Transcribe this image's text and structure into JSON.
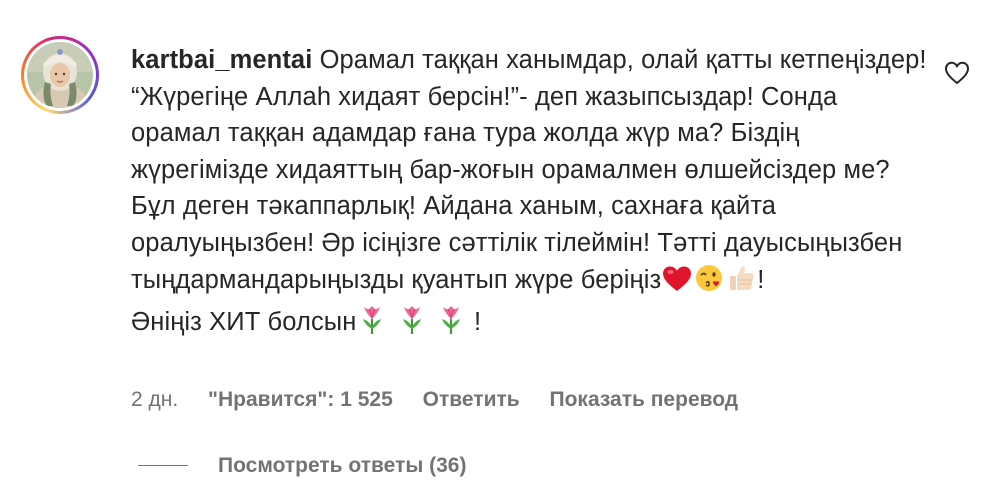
{
  "comment": {
    "username": "kartbai_mentai",
    "text_1": " Орамал таққан ханымдар, олай қатты кетпеңіздер! “Жүрегіңе Аллаһ хидаят берсін!”- деп жазыпсыздар! Сонда орамал таққан адамдар ғана тура жолда жүр ма? Біздің жүрегімізде хидаяттың бар-жоғын орамалмен өлшейсіздер ме? Бұл деген тәкаппарлық! Айдана ханым, сахнаға қайта оралуыңызбен! Әр ісіңізге сәттілік тілеймін! Тәтті дауысыңызбен тыңдармандарыңызды қуантып жүре беріңіз",
    "text_2": "!",
    "text_3": "Әніңіз ХИТ болсын",
    "text_4": " !",
    "emoji_row_1": [
      "heart-emoji",
      "kiss-wink-emoji",
      "thumbs-up-emoji"
    ],
    "emoji_row_2": [
      "tulip-emoji",
      "tulip-emoji",
      "tulip-emoji"
    ]
  },
  "meta": {
    "time": "2 дн.",
    "likes": "\"Нравится\": 1 525",
    "reply": "Ответить",
    "translate": "Показать перевод"
  },
  "replies": {
    "label": "Посмотреть ответы (36)"
  },
  "icons": {
    "like": "heart-outline-icon"
  },
  "colors": {
    "text": "#262626",
    "secondary": "#737373",
    "background": "#ffffff"
  }
}
